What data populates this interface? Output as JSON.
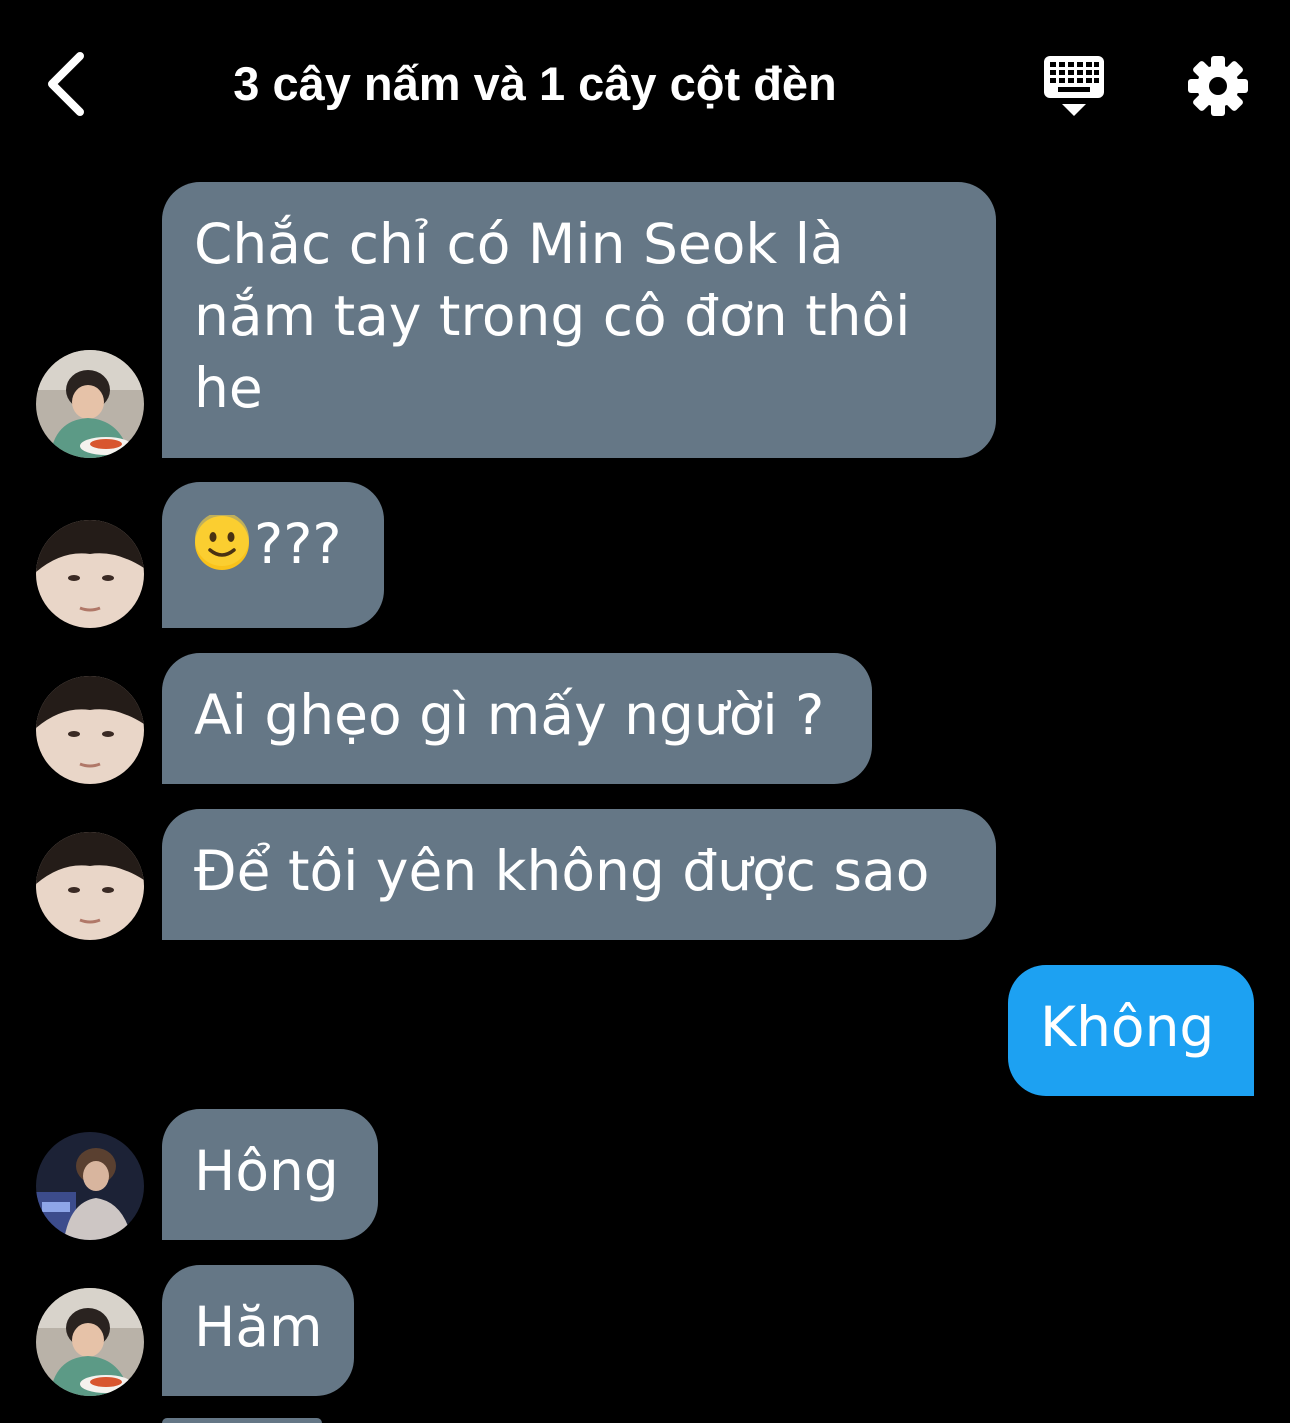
{
  "header": {
    "title": "3 cây nấm và 1 cây cột đèn",
    "back_icon": "chevron-left-icon",
    "keyboard_icon": "keyboard-hide-icon",
    "settings_icon": "gear-icon"
  },
  "colors": {
    "background": "#000000",
    "received_bubble": "#657786",
    "sent_bubble": "#1da1f2",
    "text": "#ffffff"
  },
  "messages": [
    {
      "sender": "them",
      "avatar": "avatar-eating",
      "lines": [
        "Chắc chỉ có Min Seok là",
        "nắm tay trong cô đơn thôi",
        "he"
      ]
    },
    {
      "sender": "them",
      "avatar": "avatar-closeup",
      "emoji": "slightly-smiling-face-icon",
      "text": "???"
    },
    {
      "sender": "them",
      "avatar": "avatar-closeup",
      "text": "Ai ghẹo gì mấy người ?"
    },
    {
      "sender": "them",
      "avatar": "avatar-closeup",
      "text": "Để tôi yên không được sao"
    },
    {
      "sender": "me",
      "text": "Không"
    },
    {
      "sender": "them",
      "avatar": "avatar-dark",
      "text": "Hông"
    },
    {
      "sender": "them",
      "avatar": "avatar-eating",
      "text": "Hăm"
    }
  ]
}
